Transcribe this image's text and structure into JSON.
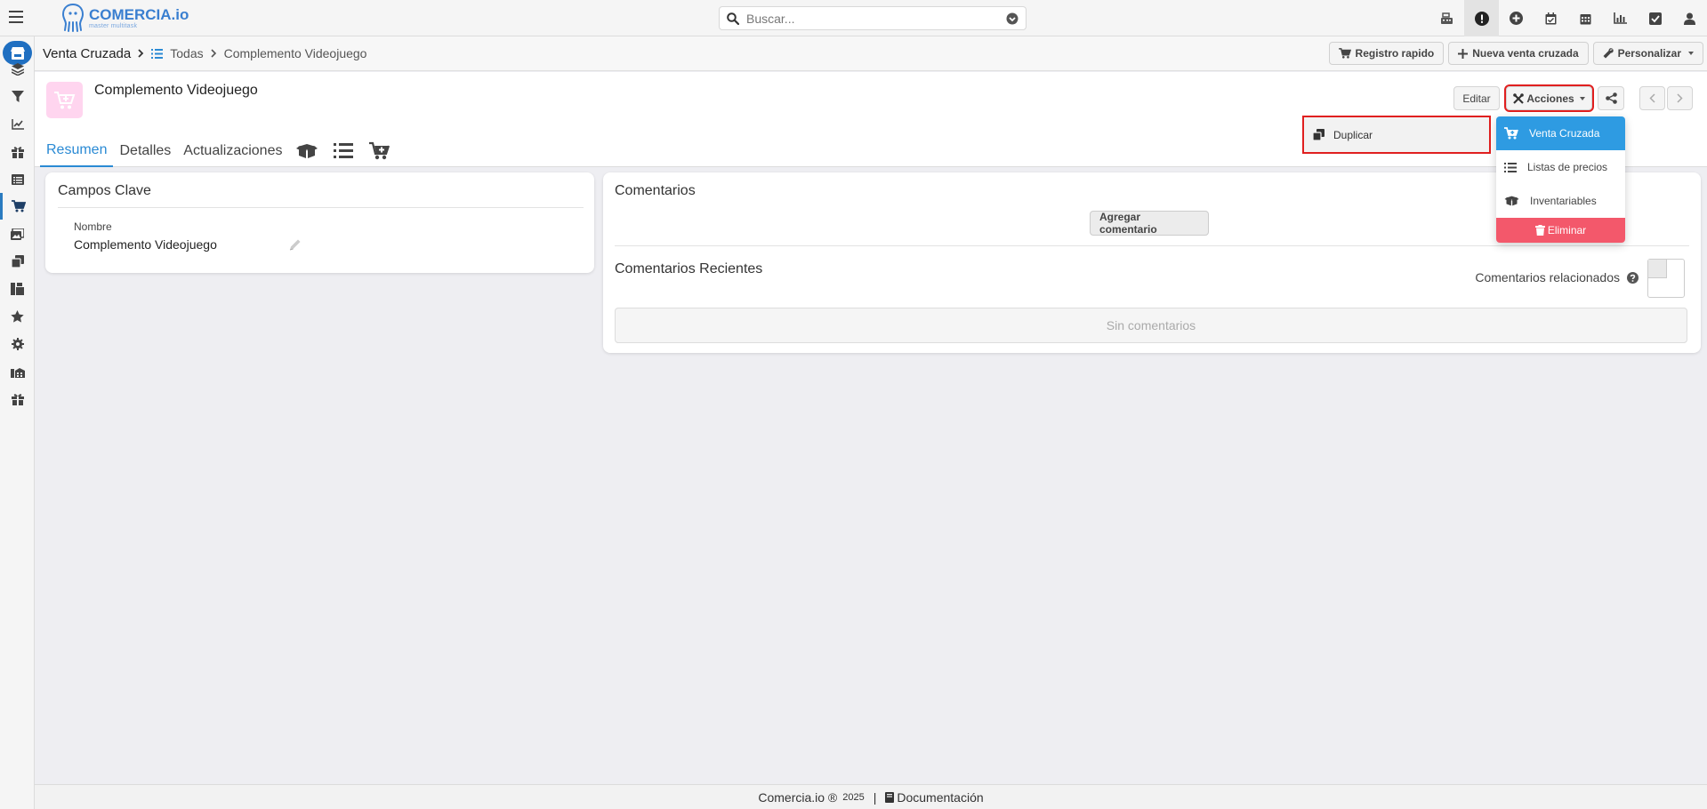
{
  "app": {
    "logo_name": "COMERCIA.io",
    "logo_sub": "master multitask"
  },
  "search": {
    "placeholder": "Buscar..."
  },
  "top_icons": [
    "cash-register-icon",
    "alert-icon",
    "plus-circle-icon",
    "calendar-check-icon",
    "calendar-icon",
    "bar-chart-icon",
    "checkbox-icon",
    "user-icon"
  ],
  "sidebar_icons": [
    "layers-icon",
    "filter-icon",
    "line-chart-icon",
    "gift-icon",
    "list-icon",
    "cart-icon",
    "images-icon",
    "copies-icon",
    "boxes-icon",
    "star-icon",
    "cog-icon",
    "warehouse-icon",
    "gift-icon"
  ],
  "breadcrumb": {
    "module": "Venta Cruzada",
    "list": "Todas",
    "current": "Complemento Videojuego"
  },
  "header_actions": {
    "quick": "Registro rapido",
    "new": "Nueva venta cruzada",
    "customize": "Personalizar"
  },
  "record": {
    "title": "Complemento Videojuego",
    "tabs": [
      "Resumen",
      "Detalles",
      "Actualizaciones"
    ],
    "edit_label": "Editar",
    "actions_label": "Acciones"
  },
  "key_fields": {
    "title": "Campos Clave",
    "name_label": "Nombre",
    "name_value": "Complemento Videojuego"
  },
  "comments": {
    "title": "Comentarios",
    "add_button": "Agregar comentario",
    "recent_title": "Comentarios Recientes",
    "related_label": "Comentarios relacionados",
    "empty": "Sin comentarios"
  },
  "actions_menu": {
    "duplicate": "Duplicar",
    "items": [
      "Venta Cruzada",
      "Listas de precios",
      "Inventariables"
    ],
    "delete": "Eliminar"
  },
  "footer": {
    "brand": "Comercia.io ®",
    "year": "2025",
    "separator": "|",
    "docs": "Documentación"
  },
  "colors": {
    "accent": "#2a8ad4",
    "brand": "#1f6fc1",
    "danger": "#f3586b",
    "highlight": "#e01f1f",
    "avatar_bg": "#ffd5ef"
  }
}
